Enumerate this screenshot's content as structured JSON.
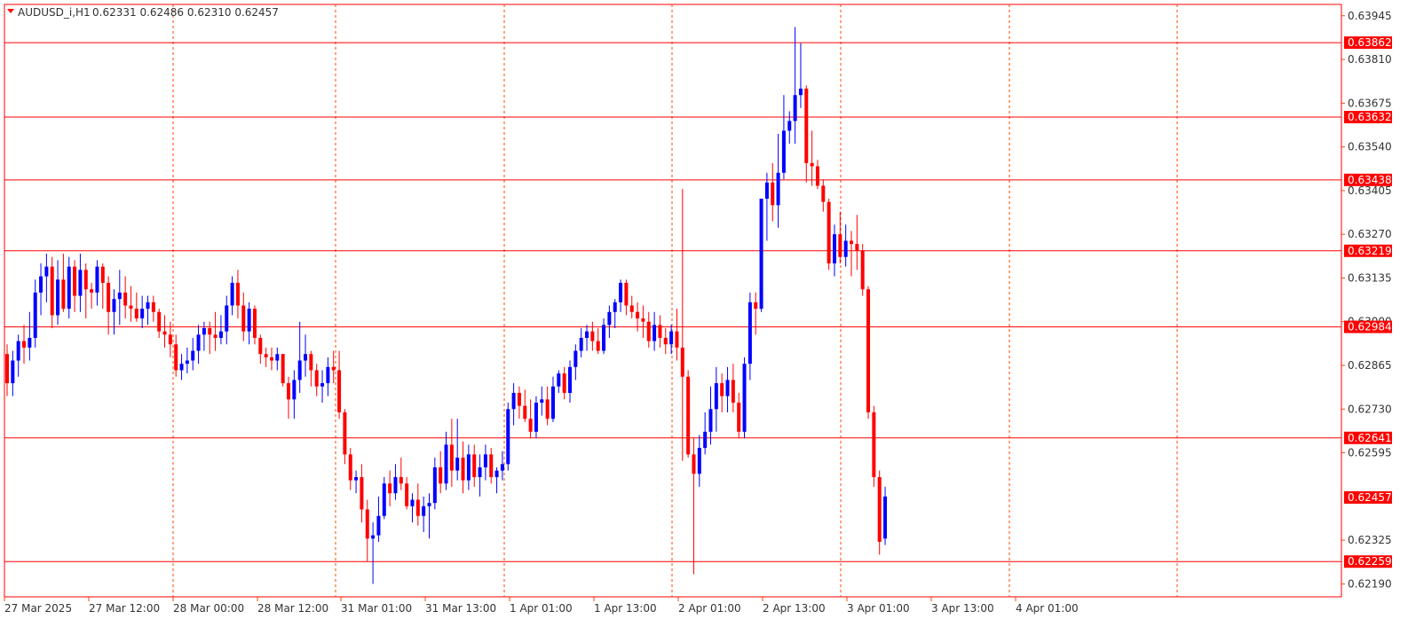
{
  "header": {
    "symbol": "AUDUSD_i,H1",
    "ohlc": "0.62331 0.62486 0.62310 0.62457"
  },
  "colors": {
    "bull": "#0000ff",
    "bear": "#ff0000",
    "grid": "#ff4500",
    "hline": "#ff0000",
    "current_price": "#ff0000",
    "text": "#333333",
    "frame": "#ff0000"
  },
  "chart_data": {
    "type": "candlestick",
    "timeframe": "H1",
    "ylim": [
      0.6215,
      0.6398
    ],
    "y_ticks": [
      "0.63945",
      "0.63810",
      "0.63675",
      "0.63540",
      "0.63405",
      "0.63270",
      "0.63135",
      "0.63000",
      "0.62865",
      "0.62730",
      "0.62595",
      "0.62325",
      "0.62190"
    ],
    "x_ticks": [
      "27 Mar 2025",
      "27 Mar 12:00",
      "28 Mar 00:00",
      "28 Mar 12:00",
      "31 Mar 01:00",
      "31 Mar 13:00",
      "1 Apr 01:00",
      "1 Apr 13:00",
      "2 Apr 01:00",
      "2 Apr 13:00",
      "3 Apr 01:00",
      "3 Apr 13:00",
      "4 Apr 01:00"
    ],
    "horizontal_levels": [
      "0.63862",
      "0.63632",
      "0.63438",
      "0.63219",
      "0.62984",
      "0.62641",
      "0.62259"
    ],
    "current_price": "0.62457",
    "candles": [
      [
        0.629,
        0.6293,
        0.6277,
        0.6281
      ],
      [
        0.6281,
        0.6291,
        0.6277,
        0.6288
      ],
      [
        0.6288,
        0.6296,
        0.6283,
        0.6294
      ],
      [
        0.6294,
        0.6299,
        0.6287,
        0.6292
      ],
      [
        0.6292,
        0.6303,
        0.6288,
        0.6295
      ],
      [
        0.6295,
        0.6313,
        0.6292,
        0.6309
      ],
      [
        0.6309,
        0.6318,
        0.6302,
        0.6314
      ],
      [
        0.6314,
        0.6321,
        0.6306,
        0.6317
      ],
      [
        0.6317,
        0.632,
        0.6298,
        0.6302
      ],
      [
        0.6302,
        0.6319,
        0.6299,
        0.6313
      ],
      [
        0.6313,
        0.6321,
        0.6303,
        0.6304
      ],
      [
        0.6304,
        0.632,
        0.6301,
        0.6317
      ],
      [
        0.6317,
        0.6319,
        0.6303,
        0.6308
      ],
      [
        0.6308,
        0.6321,
        0.6303,
        0.6316
      ],
      [
        0.6316,
        0.6318,
        0.6301,
        0.631
      ],
      [
        0.631,
        0.6312,
        0.6304,
        0.6309
      ],
      [
        0.6309,
        0.6319,
        0.6305,
        0.6317
      ],
      [
        0.6317,
        0.6318,
        0.6304,
        0.6312
      ],
      [
        0.6312,
        0.6314,
        0.6296,
        0.6303
      ],
      [
        0.6303,
        0.631,
        0.6296,
        0.6307
      ],
      [
        0.6307,
        0.6316,
        0.6299,
        0.6309
      ],
      [
        0.6309,
        0.6314,
        0.6301,
        0.6305
      ],
      [
        0.6305,
        0.6311,
        0.63,
        0.6304
      ],
      [
        0.6304,
        0.6309,
        0.63,
        0.6301
      ],
      [
        0.6301,
        0.6308,
        0.6298,
        0.6304
      ],
      [
        0.6304,
        0.6308,
        0.6299,
        0.6306
      ],
      [
        0.6306,
        0.6308,
        0.63,
        0.6303
      ],
      [
        0.6303,
        0.6304,
        0.6295,
        0.6297
      ],
      [
        0.6297,
        0.6302,
        0.6292,
        0.6296
      ],
      [
        0.6296,
        0.63,
        0.6289,
        0.6293
      ],
      [
        0.6293,
        0.6296,
        0.6283,
        0.6285
      ],
      [
        0.6285,
        0.629,
        0.6282,
        0.6287
      ],
      [
        0.6287,
        0.6292,
        0.6284,
        0.6288
      ],
      [
        0.6288,
        0.6295,
        0.6285,
        0.6291
      ],
      [
        0.6291,
        0.6299,
        0.6287,
        0.6296
      ],
      [
        0.6296,
        0.63,
        0.6291,
        0.6298
      ],
      [
        0.6298,
        0.63,
        0.629,
        0.6296
      ],
      [
        0.6296,
        0.6303,
        0.6291,
        0.6295
      ],
      [
        0.6295,
        0.6302,
        0.6293,
        0.6297
      ],
      [
        0.6297,
        0.6308,
        0.6293,
        0.6305
      ],
      [
        0.6305,
        0.6314,
        0.6302,
        0.6312
      ],
      [
        0.6312,
        0.6316,
        0.6301,
        0.6305
      ],
      [
        0.6305,
        0.6309,
        0.6294,
        0.6297
      ],
      [
        0.6297,
        0.6306,
        0.6293,
        0.6304
      ],
      [
        0.6304,
        0.6305,
        0.6293,
        0.6295
      ],
      [
        0.6295,
        0.6296,
        0.6287,
        0.629
      ],
      [
        0.629,
        0.6292,
        0.6286,
        0.6289
      ],
      [
        0.6289,
        0.6292,
        0.6285,
        0.6288
      ],
      [
        0.6288,
        0.6292,
        0.6285,
        0.629
      ],
      [
        0.629,
        0.629,
        0.628,
        0.6281
      ],
      [
        0.6281,
        0.6283,
        0.627,
        0.6276
      ],
      [
        0.6276,
        0.6285,
        0.627,
        0.6282
      ],
      [
        0.6282,
        0.63,
        0.6278,
        0.6288
      ],
      [
        0.6288,
        0.6296,
        0.6283,
        0.629
      ],
      [
        0.629,
        0.6291,
        0.628,
        0.6285
      ],
      [
        0.6285,
        0.6287,
        0.6277,
        0.628
      ],
      [
        0.628,
        0.6285,
        0.6275,
        0.6281
      ],
      [
        0.6281,
        0.6289,
        0.6277,
        0.6286
      ],
      [
        0.6286,
        0.6291,
        0.6281,
        0.6285
      ],
      [
        0.6285,
        0.6291,
        0.627,
        0.6272
      ],
      [
        0.6272,
        0.6273,
        0.6256,
        0.6259
      ],
      [
        0.6259,
        0.6261,
        0.6248,
        0.6251
      ],
      [
        0.6251,
        0.6254,
        0.6247,
        0.6252
      ],
      [
        0.6252,
        0.6256,
        0.6238,
        0.6242
      ],
      [
        0.6242,
        0.6245,
        0.6226,
        0.6233
      ],
      [
        0.6233,
        0.6238,
        0.6219,
        0.6234
      ],
      [
        0.6234,
        0.6246,
        0.6232,
        0.624
      ],
      [
        0.624,
        0.6252,
        0.6239,
        0.625
      ],
      [
        0.625,
        0.6254,
        0.6243,
        0.6247
      ],
      [
        0.6247,
        0.6256,
        0.6245,
        0.6252
      ],
      [
        0.6252,
        0.6258,
        0.6248,
        0.625
      ],
      [
        0.625,
        0.6252,
        0.6242,
        0.6243
      ],
      [
        0.6243,
        0.6247,
        0.6238,
        0.6245
      ],
      [
        0.6245,
        0.625,
        0.6237,
        0.624
      ],
      [
        0.624,
        0.6246,
        0.6235,
        0.6243
      ],
      [
        0.6243,
        0.6247,
        0.6233,
        0.6244
      ],
      [
        0.6244,
        0.6258,
        0.6242,
        0.6255
      ],
      [
        0.6255,
        0.626,
        0.6247,
        0.625
      ],
      [
        0.625,
        0.6266,
        0.6248,
        0.6262
      ],
      [
        0.6262,
        0.627,
        0.6249,
        0.6254
      ],
      [
        0.6254,
        0.627,
        0.6251,
        0.6258
      ],
      [
        0.6258,
        0.6263,
        0.6247,
        0.6251
      ],
      [
        0.6251,
        0.6262,
        0.6248,
        0.6259
      ],
      [
        0.6259,
        0.6262,
        0.6249,
        0.6252
      ],
      [
        0.6252,
        0.6259,
        0.6246,
        0.6255
      ],
      [
        0.6255,
        0.6262,
        0.6251,
        0.6259
      ],
      [
        0.6259,
        0.6261,
        0.625,
        0.6252
      ],
      [
        0.6252,
        0.6255,
        0.6247,
        0.6254
      ],
      [
        0.6254,
        0.626,
        0.6251,
        0.6256
      ],
      [
        0.6256,
        0.6275,
        0.6254,
        0.6273
      ],
      [
        0.6273,
        0.6281,
        0.6268,
        0.6278
      ],
      [
        0.6278,
        0.628,
        0.627,
        0.6274
      ],
      [
        0.6274,
        0.6279,
        0.6269,
        0.627
      ],
      [
        0.627,
        0.6276,
        0.6264,
        0.6266
      ],
      [
        0.6266,
        0.6277,
        0.6264,
        0.6275
      ],
      [
        0.6275,
        0.628,
        0.6271,
        0.6276
      ],
      [
        0.6276,
        0.628,
        0.6268,
        0.627
      ],
      [
        0.627,
        0.6283,
        0.6269,
        0.628
      ],
      [
        0.628,
        0.6285,
        0.6278,
        0.6284
      ],
      [
        0.6284,
        0.6286,
        0.6276,
        0.6278
      ],
      [
        0.6278,
        0.6288,
        0.6275,
        0.6286
      ],
      [
        0.6286,
        0.6293,
        0.6282,
        0.6291
      ],
      [
        0.6291,
        0.6298,
        0.6289,
        0.6295
      ],
      [
        0.6295,
        0.6299,
        0.6291,
        0.6297
      ],
      [
        0.6297,
        0.63,
        0.6291,
        0.6294
      ],
      [
        0.6294,
        0.6298,
        0.629,
        0.6291
      ],
      [
        0.6291,
        0.6301,
        0.629,
        0.6299
      ],
      [
        0.6299,
        0.6305,
        0.6295,
        0.6303
      ],
      [
        0.6303,
        0.6307,
        0.6298,
        0.6306
      ],
      [
        0.6306,
        0.6313,
        0.6303,
        0.6312
      ],
      [
        0.6312,
        0.6313,
        0.6302,
        0.6305
      ],
      [
        0.6305,
        0.6308,
        0.6301,
        0.6303
      ],
      [
        0.6303,
        0.6306,
        0.6297,
        0.6301
      ],
      [
        0.6301,
        0.6305,
        0.6295,
        0.63
      ],
      [
        0.63,
        0.6303,
        0.6292,
        0.6294
      ],
      [
        0.6294,
        0.6303,
        0.6291,
        0.6299
      ],
      [
        0.6299,
        0.6302,
        0.6292,
        0.6295
      ],
      [
        0.6295,
        0.6298,
        0.629,
        0.6293
      ],
      [
        0.6293,
        0.6299,
        0.629,
        0.6297
      ],
      [
        0.6297,
        0.6304,
        0.6288,
        0.6292
      ],
      [
        0.6292,
        0.6341,
        0.6257,
        0.6283
      ],
      [
        0.6283,
        0.6285,
        0.6258,
        0.6259
      ],
      [
        0.6259,
        0.6264,
        0.6222,
        0.6253
      ],
      [
        0.6253,
        0.6265,
        0.6249,
        0.6261
      ],
      [
        0.6261,
        0.6272,
        0.6259,
        0.6266
      ],
      [
        0.6266,
        0.628,
        0.6262,
        0.6273
      ],
      [
        0.6273,
        0.6286,
        0.6266,
        0.6281
      ],
      [
        0.6281,
        0.6284,
        0.6272,
        0.6277
      ],
      [
        0.6277,
        0.6286,
        0.6272,
        0.6282
      ],
      [
        0.6282,
        0.6287,
        0.6272,
        0.6275
      ],
      [
        0.6275,
        0.6278,
        0.6264,
        0.6266
      ],
      [
        0.6266,
        0.6289,
        0.6264,
        0.6287
      ],
      [
        0.6287,
        0.6309,
        0.6282,
        0.6306
      ],
      [
        0.6306,
        0.6309,
        0.6296,
        0.6304
      ],
      [
        0.6304,
        0.6337,
        0.6303,
        0.6338
      ],
      [
        0.6338,
        0.6346,
        0.6325,
        0.6343
      ],
      [
        0.6343,
        0.6349,
        0.6331,
        0.6336
      ],
      [
        0.6336,
        0.6358,
        0.6329,
        0.6346
      ],
      [
        0.6346,
        0.637,
        0.6344,
        0.6359
      ],
      [
        0.6359,
        0.6365,
        0.6355,
        0.6362
      ],
      [
        0.6362,
        0.6391,
        0.6355,
        0.637
      ],
      [
        0.637,
        0.6386,
        0.6366,
        0.6372
      ],
      [
        0.6372,
        0.6373,
        0.6343,
        0.6349
      ],
      [
        0.6349,
        0.6359,
        0.6342,
        0.6348
      ],
      [
        0.6348,
        0.635,
        0.6341,
        0.6342
      ],
      [
        0.6342,
        0.6344,
        0.6334,
        0.6337
      ],
      [
        0.6337,
        0.6338,
        0.6316,
        0.6318
      ],
      [
        0.6318,
        0.633,
        0.6314,
        0.6327
      ],
      [
        0.6327,
        0.6334,
        0.6318,
        0.632
      ],
      [
        0.632,
        0.633,
        0.6317,
        0.6325
      ],
      [
        0.6325,
        0.6328,
        0.6314,
        0.6324
      ],
      [
        0.6324,
        0.6333,
        0.6316,
        0.6322
      ],
      [
        0.6322,
        0.6324,
        0.6308,
        0.631
      ],
      [
        0.631,
        0.6311,
        0.627,
        0.6272
      ],
      [
        0.6272,
        0.6274,
        0.6249,
        0.6252
      ],
      [
        0.6252,
        0.6254,
        0.6228,
        0.6232
      ],
      [
        0.6233,
        0.6249,
        0.6231,
        0.6246
      ]
    ]
  }
}
